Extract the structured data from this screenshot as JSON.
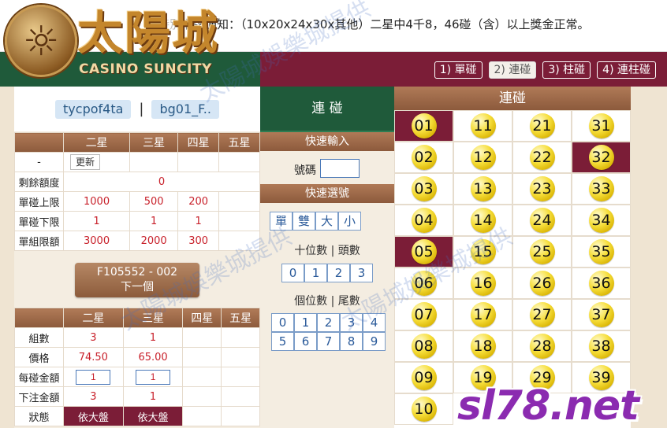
{
  "announcement": "特別擋牌通知：（10x20x24x30x其他）二星中4千8，46碰（含）以上獎金正常。",
  "logo": {
    "chinese": "太陽城",
    "latin": "CASINO SUNCITY"
  },
  "tabs": [
    {
      "label": "1) 單碰",
      "active": false
    },
    {
      "label": "2) 連碰",
      "active": true
    },
    {
      "label": "3) 柱碰",
      "active": false
    },
    {
      "label": "4) 連柱碰",
      "active": false
    }
  ],
  "account": {
    "user": "tycpof4ta",
    "separator": "|",
    "game": "bg01_F.."
  },
  "limits": {
    "headers": [
      "二星",
      "三星",
      "四星",
      "五星"
    ],
    "refresh_label": "更新",
    "dash": "-",
    "rows": [
      {
        "label": "剩餘額度",
        "value": "0"
      },
      {
        "label": "單碰上限",
        "values": [
          "1000",
          "500",
          "200",
          ""
        ]
      },
      {
        "label": "單碰下限",
        "values": [
          "1",
          "1",
          "1",
          ""
        ]
      },
      {
        "label": "單組限額",
        "values": [
          "3000",
          "2000",
          "300",
          ""
        ]
      }
    ]
  },
  "next_button": {
    "line1": "F105552 - 002",
    "line2": "下一個"
  },
  "bets": {
    "headers": [
      "二星",
      "三星",
      "四星",
      "五星"
    ],
    "groups_label": "組數",
    "groups": [
      "3",
      "1"
    ],
    "price_label": "價格",
    "prices": [
      "74.50",
      "65.00"
    ],
    "per_label": "每碰金額",
    "per": [
      "1",
      "1"
    ],
    "total_label": "下注金額",
    "totals": [
      "3",
      "1"
    ],
    "status_label": "狀態",
    "status": [
      "依大盤",
      "依大盤"
    ]
  },
  "middle": {
    "title": "連 碰",
    "quick_input": "快速輸入",
    "number_label": "號碼",
    "quick_select": "快速選號",
    "parity": [
      "單",
      "雙",
      "大",
      "小"
    ],
    "tens_label": "十位數 | 頭數",
    "tens": [
      "0",
      "1",
      "2",
      "3"
    ],
    "units_label": "個位數 | 尾數",
    "units_row1": [
      "0",
      "1",
      "2",
      "3",
      "4"
    ],
    "units_row2": [
      "5",
      "6",
      "7",
      "8",
      "9"
    ]
  },
  "grid": {
    "title": "連碰",
    "selected_color": "#7b1d37",
    "balls": [
      {
        "n": "01",
        "sel": true
      },
      {
        "n": "11",
        "sel": false
      },
      {
        "n": "21",
        "sel": false
      },
      {
        "n": "31",
        "sel": false
      },
      {
        "n": "02",
        "sel": false
      },
      {
        "n": "12",
        "sel": false
      },
      {
        "n": "22",
        "sel": false
      },
      {
        "n": "32",
        "sel": true
      },
      {
        "n": "03",
        "sel": false
      },
      {
        "n": "13",
        "sel": false
      },
      {
        "n": "23",
        "sel": false
      },
      {
        "n": "33",
        "sel": false
      },
      {
        "n": "04",
        "sel": false
      },
      {
        "n": "14",
        "sel": false
      },
      {
        "n": "24",
        "sel": false
      },
      {
        "n": "34",
        "sel": false
      },
      {
        "n": "05",
        "sel": true
      },
      {
        "n": "15",
        "sel": false
      },
      {
        "n": "25",
        "sel": false
      },
      {
        "n": "35",
        "sel": false
      },
      {
        "n": "06",
        "sel": false
      },
      {
        "n": "16",
        "sel": false
      },
      {
        "n": "26",
        "sel": false
      },
      {
        "n": "36",
        "sel": false
      },
      {
        "n": "07",
        "sel": false
      },
      {
        "n": "17",
        "sel": false
      },
      {
        "n": "27",
        "sel": false
      },
      {
        "n": "37",
        "sel": false
      },
      {
        "n": "08",
        "sel": false
      },
      {
        "n": "18",
        "sel": false
      },
      {
        "n": "28",
        "sel": false
      },
      {
        "n": "38",
        "sel": false
      },
      {
        "n": "09",
        "sel": false
      },
      {
        "n": "19",
        "sel": false
      },
      {
        "n": "29",
        "sel": false
      },
      {
        "n": "39",
        "sel": false
      },
      {
        "n": "10",
        "sel": false
      }
    ]
  },
  "watermark": {
    "text": "太陽城娛樂城提供",
    "brand": "sl78.net"
  }
}
